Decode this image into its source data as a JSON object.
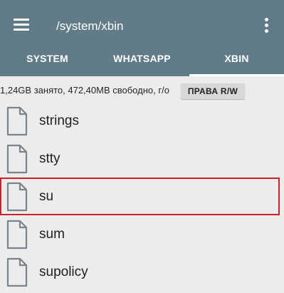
{
  "header": {
    "title": "/system/xbin",
    "menu_icon": "hamburger-menu-icon",
    "overflow_icon": "more-vert-icon",
    "background_color": "#617c88"
  },
  "tabs": [
    {
      "label": "SYSTEM",
      "active": false
    },
    {
      "label": "WHATSAPP",
      "active": false
    },
    {
      "label": "XBIN",
      "active": true
    }
  ],
  "status": {
    "storage_text": "1,24GB занято, 472,40MB свободно, г/о",
    "rw_button_label": "ПРАВА R/W"
  },
  "files": [
    {
      "name": "strings",
      "icon": "file-icon",
      "highlighted": false
    },
    {
      "name": "stty",
      "icon": "file-icon",
      "highlighted": false
    },
    {
      "name": "su",
      "icon": "file-icon",
      "highlighted": true
    },
    {
      "name": "sum",
      "icon": "file-icon",
      "highlighted": false
    },
    {
      "name": "supolicy",
      "icon": "file-icon",
      "highlighted": false
    }
  ],
  "colors": {
    "highlight_border": "#c8232b",
    "list_background": "#ececec",
    "icon_stroke": "#7a848a"
  }
}
